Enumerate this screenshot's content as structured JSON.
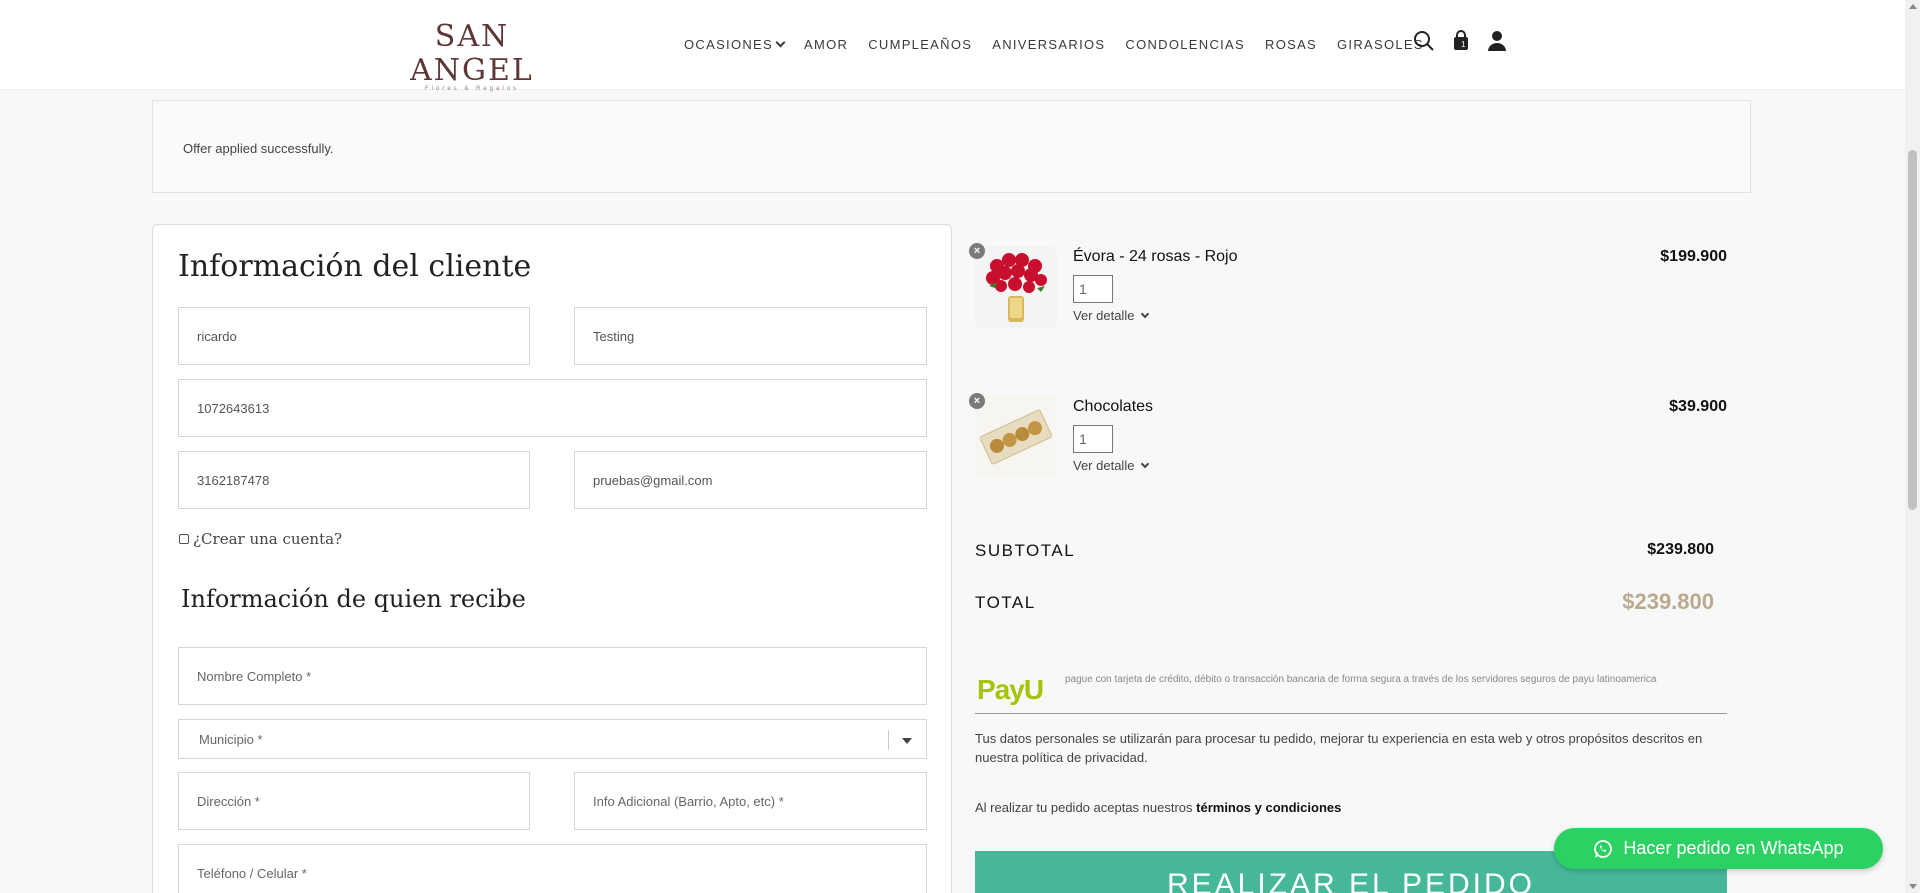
{
  "brand": {
    "name": "SAN ANGEL",
    "tagline": "Flores & Regalos"
  },
  "nav": [
    {
      "label": "OCASIONES",
      "has_dropdown": true
    },
    {
      "label": "AMOR"
    },
    {
      "label": "CUMPLEAÑOS"
    },
    {
      "label": "ANIVERSARIOS"
    },
    {
      "label": "CONDOLENCIAS"
    },
    {
      "label": "ROSAS"
    },
    {
      "label": "GIRASOLES"
    }
  ],
  "header_icons": [
    "search-icon",
    "cart-icon",
    "user-icon"
  ],
  "cart_count": "1",
  "notice": {
    "text": "Offer applied successfully."
  },
  "customer": {
    "title": "Información del cliente",
    "first_name": "ricardo",
    "last_name": "Testing",
    "document": "1072643613",
    "phone": "3162187478",
    "email": "pruebas@gmail.com",
    "create_account_label": "¿Crear una cuenta?"
  },
  "recipient": {
    "title": "Información de quien recibe",
    "full_name_placeholder": "Nombre Completo *",
    "municipality_placeholder": "Municipio *",
    "address_placeholder": "Dirección *",
    "extra_info_placeholder": "Info Adicional (Barrio, Apto, etc) *",
    "phone_placeholder": "Teléfono / Celular *"
  },
  "items": [
    {
      "name": "Évora - 24 rosas - Rojo",
      "price": "$199.900",
      "qty": "1",
      "detail_label": "Ver detalle"
    },
    {
      "name": "Chocolates",
      "price": "$39.900",
      "qty": "1",
      "detail_label": "Ver detalle"
    }
  ],
  "summary": {
    "subtotal_label": "SUBTOTAL",
    "subtotal_value": "$239.800",
    "total_label": "TOTAL",
    "total_value": "$239.800"
  },
  "payment": {
    "logo": "PayU",
    "description": "pague con tarjeta de crédito, débito o transacción bancaria de forma segura a través de los servidores seguros de payu latinoamerica"
  },
  "privacy_text": "Tus datos personales se utilizarán para procesar tu pedido, mejorar tu experiencia en esta web y otros propósitos descritos en nuestra política de privacidad.",
  "terms": {
    "prefix": "Al realizar tu pedido aceptas nuestros",
    "link": "términos y condiciones"
  },
  "order_button": "REALIZAR EL PEDIDO",
  "whatsapp_button": "Hacer pedido en WhatsApp",
  "colors": {
    "brand": "#5e3636",
    "total": "#b9a98e",
    "order_button": "#46b899",
    "whatsapp": "#2bd263",
    "payu": "#a6c307"
  }
}
